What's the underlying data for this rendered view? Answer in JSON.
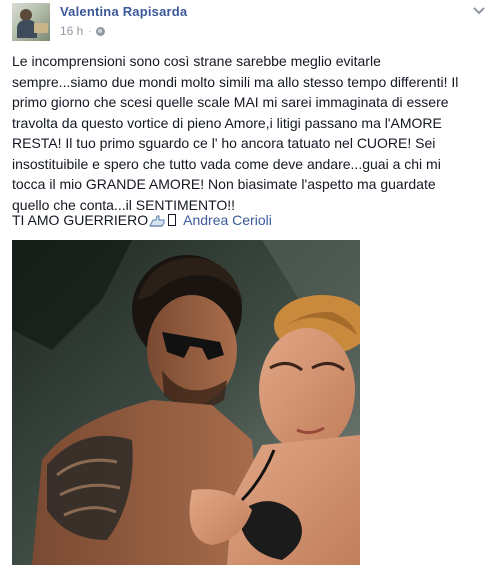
{
  "post": {
    "author": "Valentina Rapisarda",
    "time": "16 h",
    "separator": "·",
    "text": "Le incomprensioni sono così strane sarebbe meglio evitarle\nsempre...siamo due mondi molto simili ma allo stesso tempo differenti! Il\nprimo giorno che scesi quelle scale MAI mi sarei immaginata di essere\ntravolta da questo vortice di pieno Amore,i litigi passano ma l'AMORE\nRESTA! Il tuo primo sguardo ce l' ho ancora tatuato nel CUORE! Sei\ninsostituibile e spero che tutto vada come deve andare...guai a chi mi\ntocca il mio GRANDE AMORE! Non biasimate l'aspetto ma guardate\nquello che conta...il SENTIMENTO!!",
    "sign_text": "TI AMO GUERRIERO",
    "tagged_person": "Andrea Cerioli"
  },
  "icons": {
    "privacy": "globe-icon",
    "options": "chevron-down-icon",
    "emoji": "hand-icon"
  },
  "colors": {
    "link": "#3b5998",
    "text": "#141823",
    "meta": "#9197a3"
  }
}
